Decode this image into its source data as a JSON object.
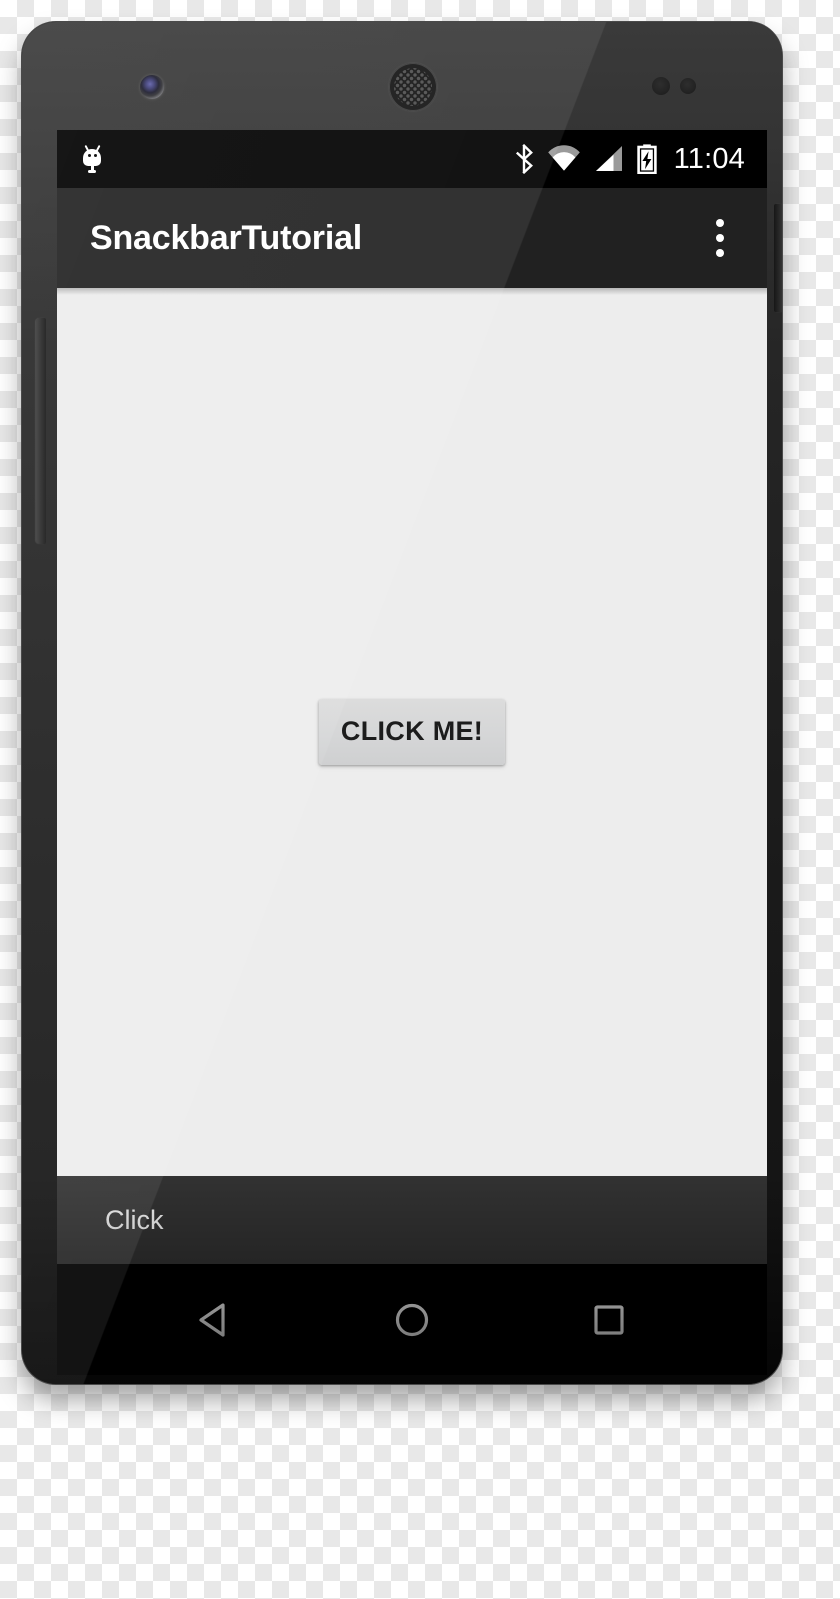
{
  "device": {
    "name": "android-phone-mockup",
    "hardware": {
      "front_camera": "camera-lens",
      "earpiece": "speaker-grille",
      "sensors": [
        "proximity-sensor",
        "light-sensor"
      ],
      "volume_rocker": "volume-rocker",
      "power_button": "power-button"
    }
  },
  "status_bar": {
    "left_icons": [
      {
        "name": "android-notification-icon",
        "glyph": "android"
      }
    ],
    "right_icons": [
      {
        "name": "bluetooth-icon",
        "glyph": "bluetooth"
      },
      {
        "name": "wifi-icon",
        "glyph": "wifi"
      },
      {
        "name": "cellular-signal-icon",
        "glyph": "signal"
      },
      {
        "name": "battery-charging-icon",
        "glyph": "battery-charging"
      }
    ],
    "time": "11:04",
    "background": "#000000",
    "foreground": "#ffffff"
  },
  "app_bar": {
    "title": "SnackbarTutorial",
    "overflow_menu_label": "More options",
    "background": "#212121",
    "title_color": "#ffffff"
  },
  "content": {
    "background": "#ededed",
    "button": {
      "label": "CLICK ME!",
      "background": "#d6d7d8",
      "text_color": "#1c1c1c"
    }
  },
  "snackbar": {
    "message": "Click",
    "action_label": "",
    "background": "#323232",
    "text_color": "#f4f4f4"
  },
  "nav_bar": {
    "background": "#000000",
    "buttons": [
      {
        "name": "back-button",
        "label": "Back",
        "glyph": "triangle-left"
      },
      {
        "name": "home-button",
        "label": "Home",
        "glyph": "circle"
      },
      {
        "name": "recents-button",
        "label": "Recent apps",
        "glyph": "square"
      }
    ]
  }
}
